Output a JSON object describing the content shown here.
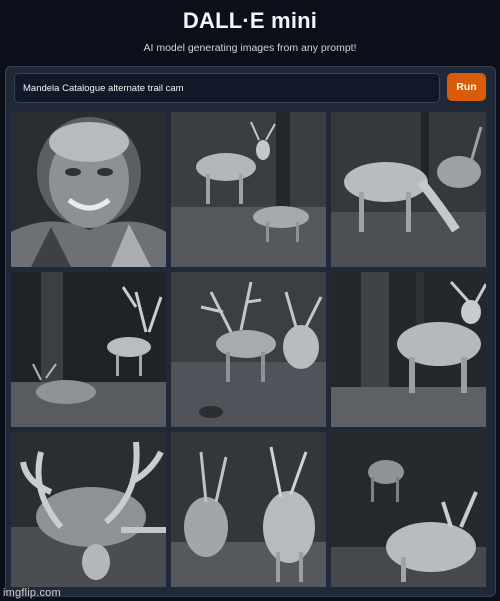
{
  "app": {
    "title": "DALL·E mini",
    "subtitle": "AI model generating images from any prompt!"
  },
  "prompt": {
    "value": "Mandela Catalogue alternate trail cam"
  },
  "run_button": {
    "label": "Run"
  },
  "results": [
    {
      "name": "smiling-man-portrait"
    },
    {
      "name": "deer-and-animal-night"
    },
    {
      "name": "deer-grazing-night"
    },
    {
      "name": "antlered-deer-forest"
    },
    {
      "name": "antlered-deer-group"
    },
    {
      "name": "antlered-deer-by-tree"
    },
    {
      "name": "large-antler-closeup"
    },
    {
      "name": "deer-pair-dark"
    },
    {
      "name": "deer-in-darkness"
    }
  ],
  "watermark": "imgflip.com",
  "colors": {
    "background": "#0b0f19",
    "panel": "#1f2937",
    "accent": "#d95c0c"
  }
}
